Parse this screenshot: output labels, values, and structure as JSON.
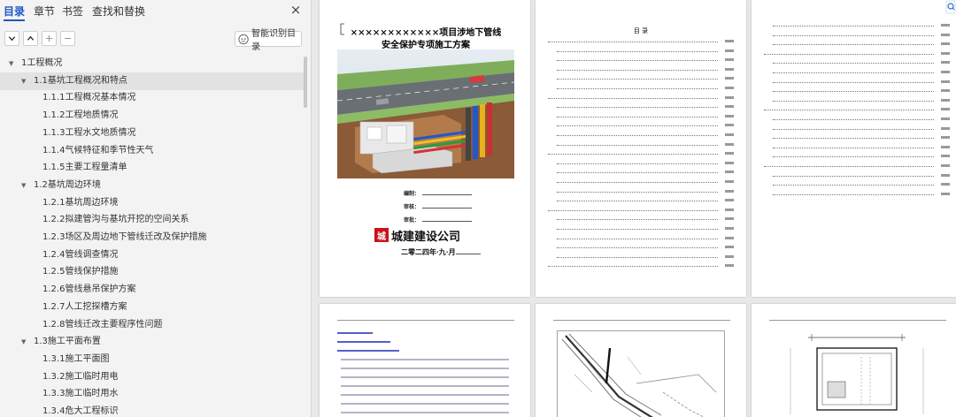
{
  "nav": {
    "tabs": [
      "目录",
      "章节",
      "书签",
      "查找和替换"
    ],
    "active_tab": 0,
    "close_label": "×",
    "smart_button_label": "智能识别目录"
  },
  "tree": [
    {
      "label": "1工程概况",
      "level": 0,
      "expanded": true
    },
    {
      "label": "1.1基坑工程概况和特点",
      "level": 1,
      "expanded": true,
      "selected": true
    },
    {
      "label": "1.1.1工程概况基本情况",
      "level": 2
    },
    {
      "label": "1.1.2工程地质情况",
      "level": 2
    },
    {
      "label": "1.1.3工程水文地质情况",
      "level": 2
    },
    {
      "label": "1.1.4气候特征和季节性天气",
      "level": 2
    },
    {
      "label": "1.1.5主要工程量清单",
      "level": 2
    },
    {
      "label": "1.2基坑周边环境",
      "level": 1,
      "expanded": true
    },
    {
      "label": "1.2.1基坑周边环境",
      "level": 2
    },
    {
      "label": "1.2.2拟建管沟与基坑开挖的空间关系",
      "level": 2
    },
    {
      "label": "1.2.3场区及周边地下管线迁改及保护措施",
      "level": 2
    },
    {
      "label": "1.2.4管线调查情况",
      "level": 2
    },
    {
      "label": "1.2.5管线保护措施",
      "level": 2
    },
    {
      "label": "1.2.6管线悬吊保护方案",
      "level": 2
    },
    {
      "label": "1.2.7人工挖探槽方案",
      "level": 2
    },
    {
      "label": "1.2.8管线迁改主要程序性问题",
      "level": 2
    },
    {
      "label": "1.3施工平面布置",
      "level": 1,
      "expanded": true
    },
    {
      "label": "1.3.1施工平面图",
      "level": 2
    },
    {
      "label": "1.3.2施工临时用电",
      "level": 2
    },
    {
      "label": "1.3.3施工临时用水",
      "level": 2
    },
    {
      "label": "1.3.4危大工程标识",
      "level": 2
    }
  ],
  "cover": {
    "title_line1": "××××××××××××项目涉地下管线",
    "title_line2": "安全保护专项施工方案",
    "fields": [
      "编制：",
      "审核：",
      "审批："
    ],
    "company_mark": "城",
    "company_name": "城建建设公司",
    "date_prefix": "二零二四年",
    "date_month": "九",
    "date_suffix": "月"
  },
  "toc_page": {
    "title": "目  录"
  },
  "colors": {
    "accent": "#1f57c3",
    "brand_red": "#c8131b"
  }
}
